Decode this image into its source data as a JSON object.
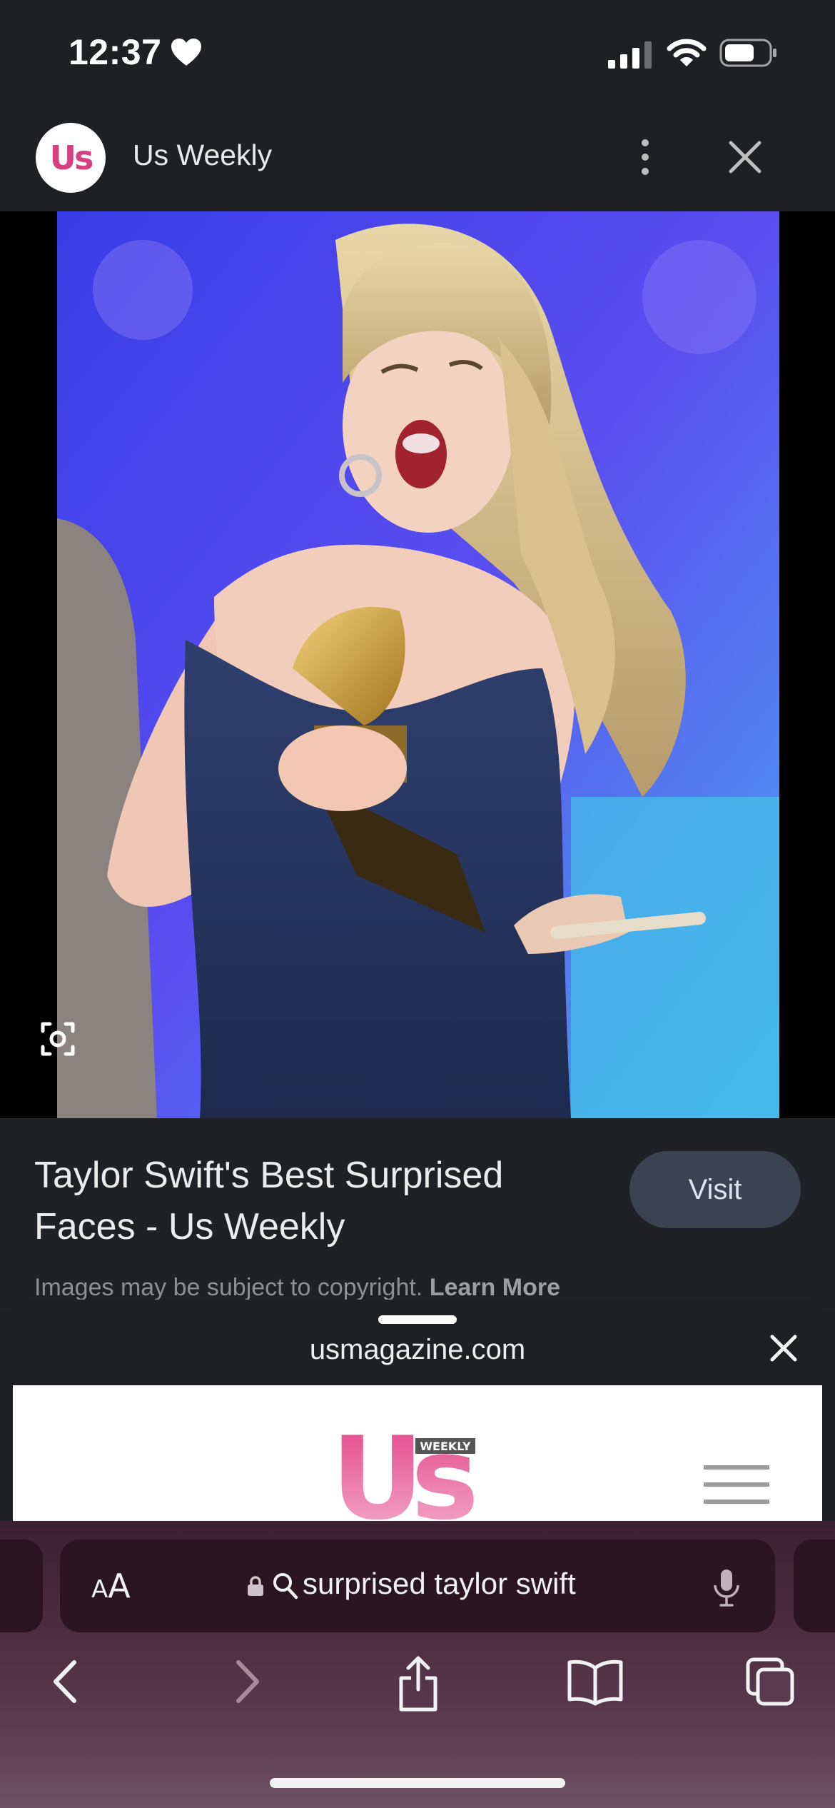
{
  "status_bar": {
    "time": "12:37",
    "icons": [
      "heart-icon",
      "cellular-signal-icon",
      "wifi-icon",
      "battery-icon"
    ]
  },
  "source": {
    "avatar_text": "Us",
    "name": "Us Weekly",
    "icons": [
      "more-vertical-icon",
      "close-icon"
    ]
  },
  "image": {
    "description_icon": "google-lens-icon"
  },
  "result": {
    "title": "Taylor Swift's Best Surprised Faces - Us Weekly",
    "visit_label": "Visit",
    "copyright_text": "Images may be subject to copyright.",
    "learn_more": "Learn More"
  },
  "sheet": {
    "domain": "usmagazine.com",
    "logo_text": "Us",
    "logo_badge": "WEEKLY"
  },
  "safari": {
    "text_size_label_small": "A",
    "text_size_label_large": "A",
    "search_query": "surprised taylor swift",
    "icons": [
      "lock-icon",
      "search-icon",
      "microphone-icon",
      "back-icon",
      "forward-icon",
      "share-icon",
      "bookmarks-icon",
      "tabs-icon"
    ]
  },
  "colors": {
    "background": "#1f2023",
    "visit_button": "#3b4252",
    "brand_pink": "#d6407e",
    "safari_bar": "#4a2c3c"
  }
}
